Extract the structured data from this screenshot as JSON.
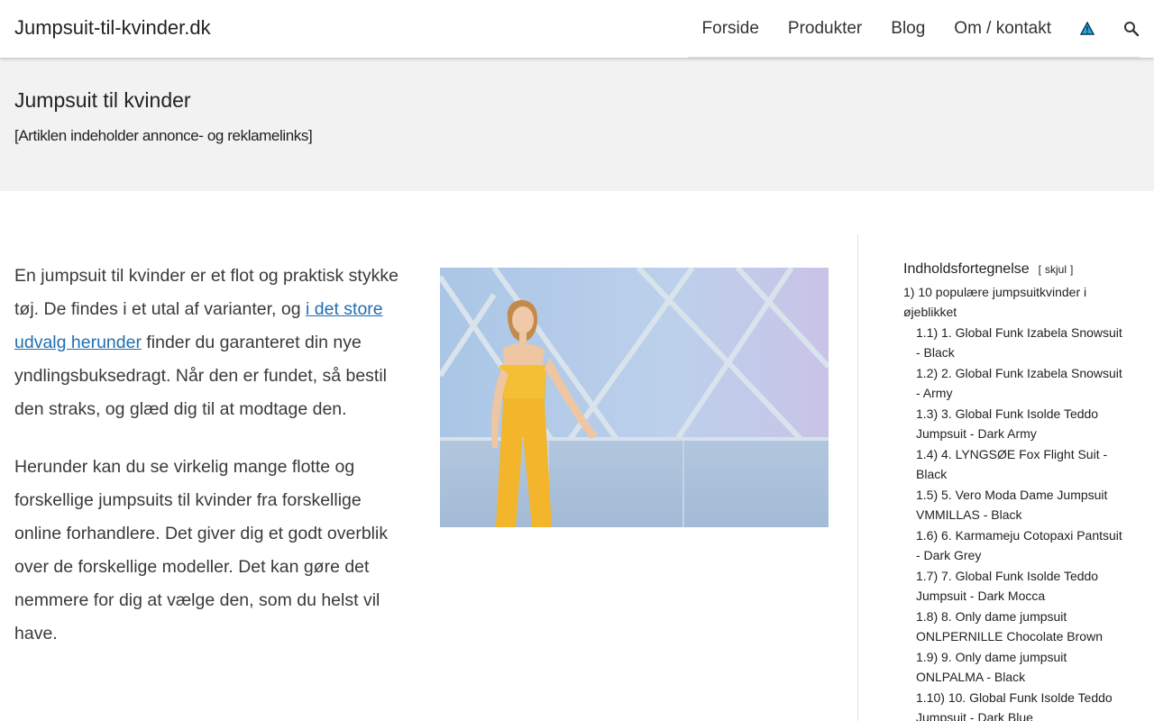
{
  "header": {
    "brand": "Jumpsuit-til-kvinder.dk",
    "nav": [
      "Forside",
      "Produkter",
      "Blog",
      "Om / kontakt"
    ],
    "icons": [
      "warning-triangle-icon",
      "search-icon"
    ]
  },
  "hero": {
    "title": "Jumpsuit til kvinder",
    "disclaimer": "[Artiklen indeholder annonce- og reklamelinks]"
  },
  "article": {
    "p1_start": "En jumpsuit til kvinder er et flot og praktisk stykke tøj. De findes i et utal af varianter, og ",
    "p1_link": "i det store udvalg herunder",
    "p1_end": " finder du garanteret din nye yndlingsbuksedragt. Når den er fundet, så bestil den straks, og glæd dig til at modtage den.",
    "p2": "Herunder kan du se virkelig mange flotte og forskellige jumpsuits til kvinder fra forskellige online forhandlere. Det giver dig et godt overblik over de forskellige modeller. Det kan gøre det nemmere for dig at vælge den, som du helst vil have."
  },
  "toc": {
    "title": "Indholdsfortegnelse",
    "toggle_open": "[",
    "toggle_label": "skjul",
    "toggle_close": "]",
    "main": {
      "num": "1)",
      "label": "10 populære jumpsuitkvinder i øjeblikket"
    },
    "items": [
      {
        "num": "1.1)",
        "label": "1. Global Funk Izabela Snowsuit - Black"
      },
      {
        "num": "1.2)",
        "label": "2. Global Funk Izabela Snowsuit - Army"
      },
      {
        "num": "1.3)",
        "label": "3. Global Funk Isolde Teddo Jumpsuit - Dark Army"
      },
      {
        "num": "1.4)",
        "label": "4. LYNGSØE Fox Flight Suit - Black"
      },
      {
        "num": "1.5)",
        "label": "5. Vero Moda Dame Jumpsuit VMMILLAS - Black"
      },
      {
        "num": "1.6)",
        "label": "6. Karmameju Cotopaxi Pantsuit - Dark Grey"
      },
      {
        "num": "1.7)",
        "label": "7. Global Funk Isolde Teddo Jumpsuit - Dark Mocca"
      },
      {
        "num": "1.8)",
        "label": "8. Only dame jumpsuit ONLPERNILLE Chocolate Brown"
      },
      {
        "num": "1.9)",
        "label": "9. Only dame jumpsuit ONLPALMA - Black"
      },
      {
        "num": "1.10)",
        "label": "10. Global Funk Isolde Teddo Jumpsuit - Dark Blue"
      }
    ]
  },
  "colors": {
    "link": "#1f6fb2",
    "hero_bg": "#f2f2f2",
    "jumpsuit": "#f2b52b"
  }
}
